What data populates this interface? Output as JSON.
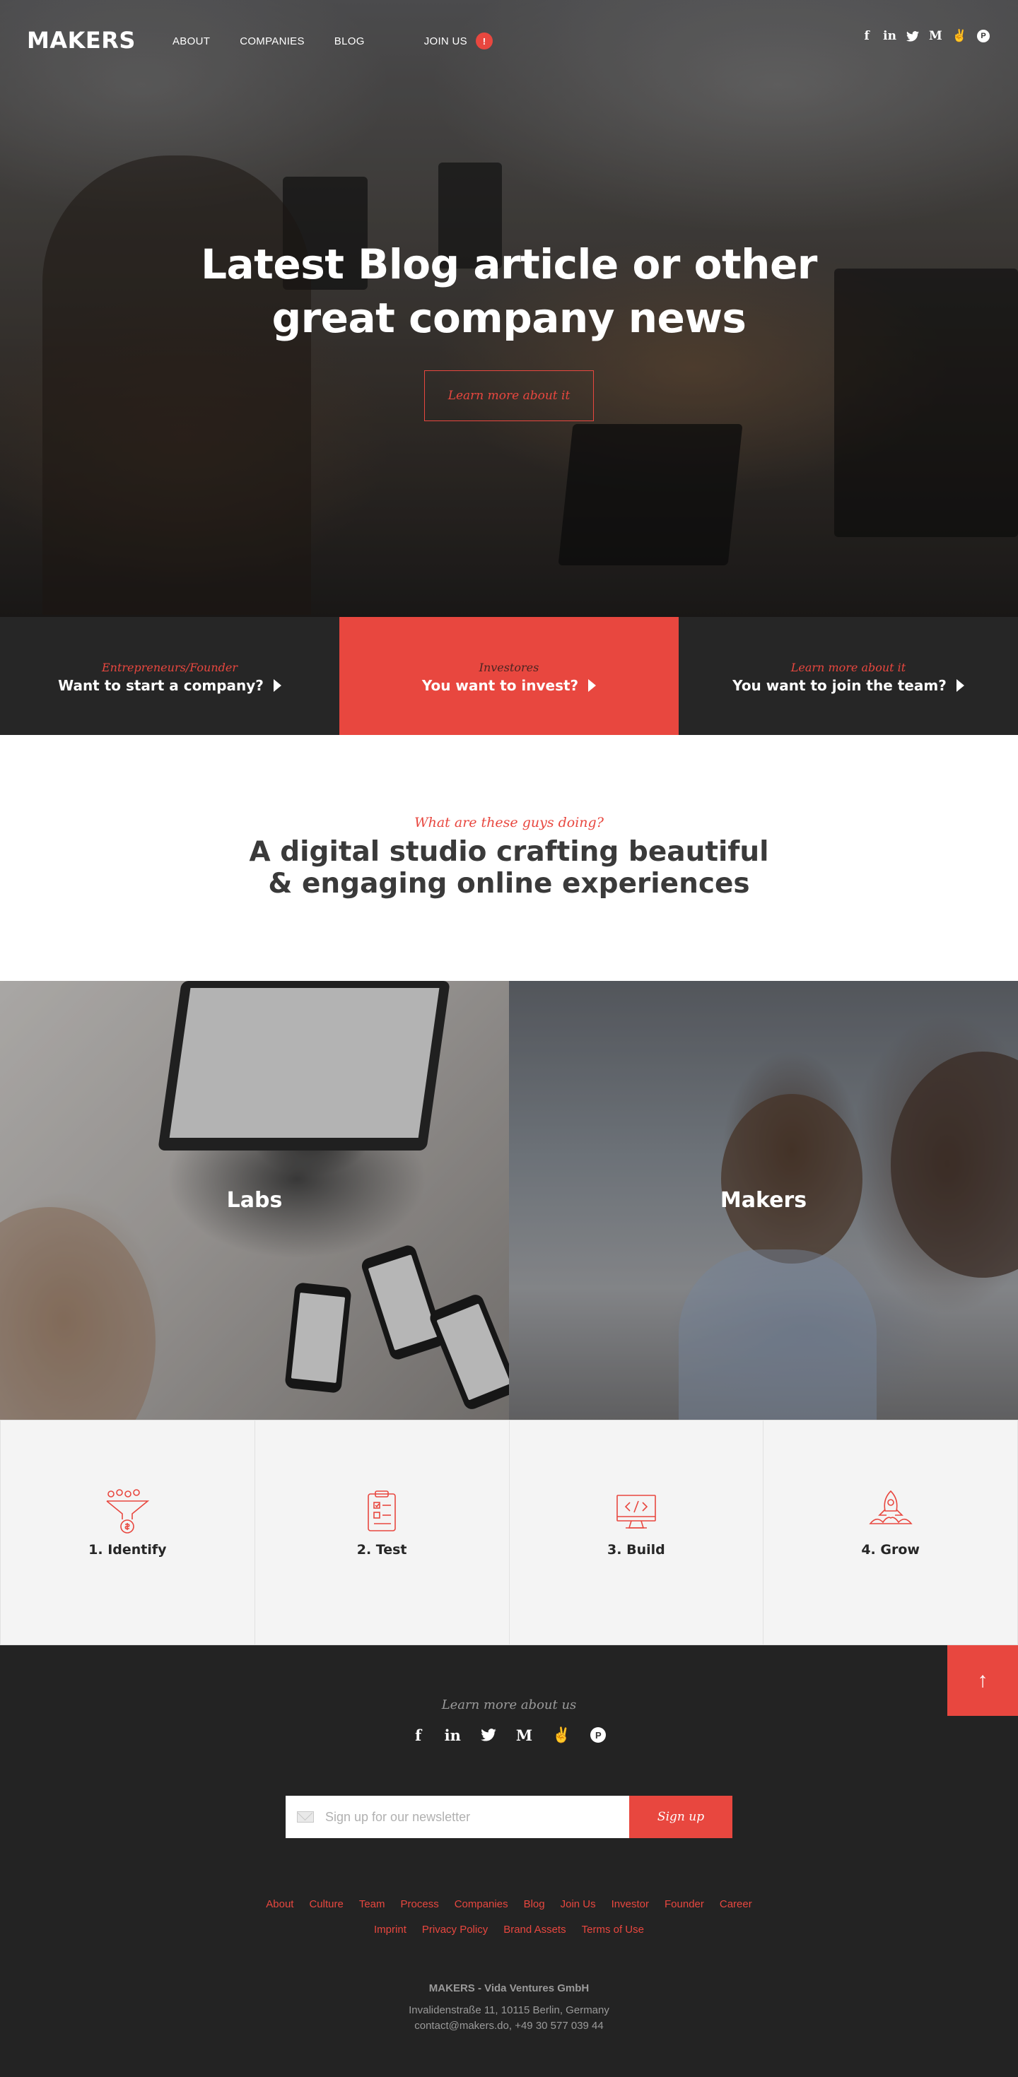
{
  "brand": {
    "logo": "MAKERS",
    "accent": "#e8473f",
    "dark": "#262626"
  },
  "nav": {
    "items": [
      {
        "label": "ABOUT"
      },
      {
        "label": "COMPANIES"
      },
      {
        "label": "BLOG"
      }
    ],
    "join": {
      "label": "JOIN US",
      "badge": "!"
    },
    "social": [
      {
        "icon": "facebook-icon",
        "glyph": "f"
      },
      {
        "icon": "linkedin-icon",
        "glyph": "in"
      },
      {
        "icon": "twitter-icon",
        "glyph": "t"
      },
      {
        "icon": "medium-icon",
        "glyph": "M"
      },
      {
        "icon": "angellist-icon",
        "glyph": "✌"
      },
      {
        "icon": "producthunt-icon",
        "glyph": "P"
      }
    ]
  },
  "hero": {
    "title_line1": "Latest Blog article or other",
    "title_line2": "great company news",
    "button": "Learn more about it"
  },
  "cta": [
    {
      "sub": "Entrepreneurs/Founder",
      "main": "Want to start a company?"
    },
    {
      "sub": "Investores",
      "main": "You want to invest?"
    },
    {
      "sub": "Learn more about it",
      "main": "You want to join the team?"
    }
  ],
  "intro": {
    "sub": "What are these guys doing?",
    "title_line1": "A digital studio crafting beautiful",
    "title_line2": "& engaging online experiences"
  },
  "split": {
    "left": "Labs",
    "right": "Makers"
  },
  "process": [
    {
      "label": "1. Identify",
      "icon": "funnel-icon"
    },
    {
      "label": "2. Test",
      "icon": "clipboard-icon"
    },
    {
      "label": "3. Build",
      "icon": "code-monitor-icon"
    },
    {
      "label": "4. Grow",
      "icon": "rocket-icon"
    }
  ],
  "footer": {
    "sub": "Learn more about us",
    "newsletter_placeholder": "Sign up for our newsletter",
    "signup": "Sign up",
    "to_top": "↑",
    "links_row1": [
      "About",
      "Culture",
      "Team",
      "Process",
      "Companies",
      "Blog",
      "Join Us",
      "Investor",
      "Founder",
      "Career"
    ],
    "links_row2": [
      "Imprint",
      "Privacy Policy",
      "Brand Assets",
      "Terms of Use"
    ],
    "company": "MAKERS - Vida Ventures GmbH",
    "address_line1": "Invalidenstraße 11, 10115 Berlin, Germany",
    "address_line2": "contact@makers.do, +49 30 577 039 44"
  }
}
